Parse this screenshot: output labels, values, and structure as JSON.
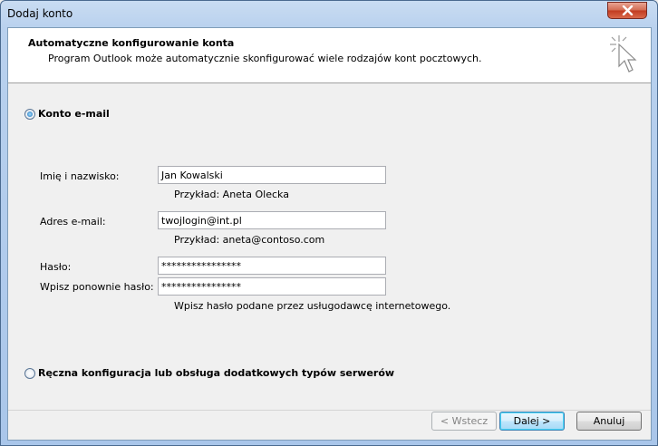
{
  "window": {
    "title": "Dodaj konto"
  },
  "header": {
    "title": "Automatyczne konfigurowanie konta",
    "subtitle": "Program Outlook może automatycznie skonfigurować wiele rodzajów kont pocztowych.",
    "icon": "cursor-sparkle-icon"
  },
  "options": {
    "email_account": {
      "label": "Konto e-mail",
      "checked": true
    },
    "manual": {
      "label": "Ręczna konfiguracja lub obsługa dodatkowych typów serwerów",
      "checked": false
    }
  },
  "form": {
    "name": {
      "label": "Imię i nazwisko:",
      "value": "Jan Kowalski",
      "hint": "Przykład: Aneta Olecka"
    },
    "email": {
      "label": "Adres e-mail:",
      "value": "twojlogin@int.pl",
      "hint": "Przykład: aneta@contoso.com"
    },
    "password": {
      "label": "Hasło:",
      "value": "****************"
    },
    "password_confirm": {
      "label": "Wpisz ponownie hasło:",
      "value": "****************",
      "hint": "Wpisz hasło podane przez usługodawcę internetowego."
    }
  },
  "buttons": {
    "back": "< Wstecz",
    "next": "Dalej >",
    "cancel": "Anuluj"
  },
  "colors": {
    "title_bar": "#b9d1ee",
    "close_button": "#c13a1f",
    "primary_button_border": "#3c7fb1"
  }
}
